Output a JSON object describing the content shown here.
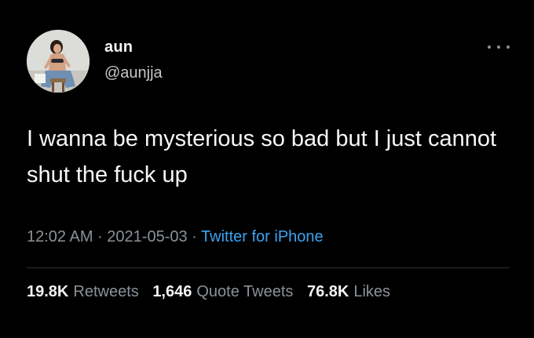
{
  "author": {
    "name": "aun",
    "handle": "@aunjja"
  },
  "tweet": {
    "text": "I wanna be mysterious so bad but I just cannot shut the fuck up"
  },
  "meta": {
    "time": "12:02 AM",
    "separator1": " · ",
    "date": "2021-05-03",
    "separator2": " · ",
    "source": "Twitter for iPhone"
  },
  "stats": {
    "retweets_count": "19.8K",
    "retweets_label": "Retweets",
    "quotes_count": "1,646",
    "quotes_label": "Quote Tweets",
    "likes_count": "76.8K",
    "likes_label": "Likes"
  },
  "icons": {
    "more": "more-horizontal-icon",
    "avatar": "profile-photo"
  },
  "colors": {
    "background": "#000000",
    "link": "#3aa3f1",
    "secondary_text": "#8b9299",
    "primary_text": "#f5f5f5"
  }
}
